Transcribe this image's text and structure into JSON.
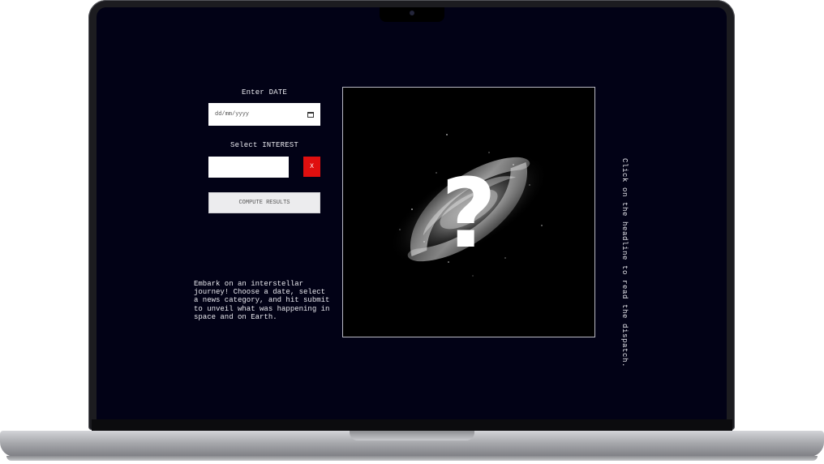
{
  "form": {
    "date_label": "Enter DATE",
    "date_placeholder": "dd/mm/yyyy",
    "interest_label": "Select INTEREST",
    "interest_value": "",
    "clear_label": "X",
    "compute_label": "COMPUTE RESULTS"
  },
  "intro_text": "Embark on an interstellar journey! Choose a date, select a news category, and hit submit to unveil what was happening in space and on Earth.",
  "image": {
    "icon": "galaxy-question-mark",
    "glyph": "?"
  },
  "hint_text": "Click on the headline to read the dispatch.",
  "colors": {
    "background": "#020216",
    "clear_button": "#e00f0f",
    "image_border": "#b9b9c4"
  }
}
